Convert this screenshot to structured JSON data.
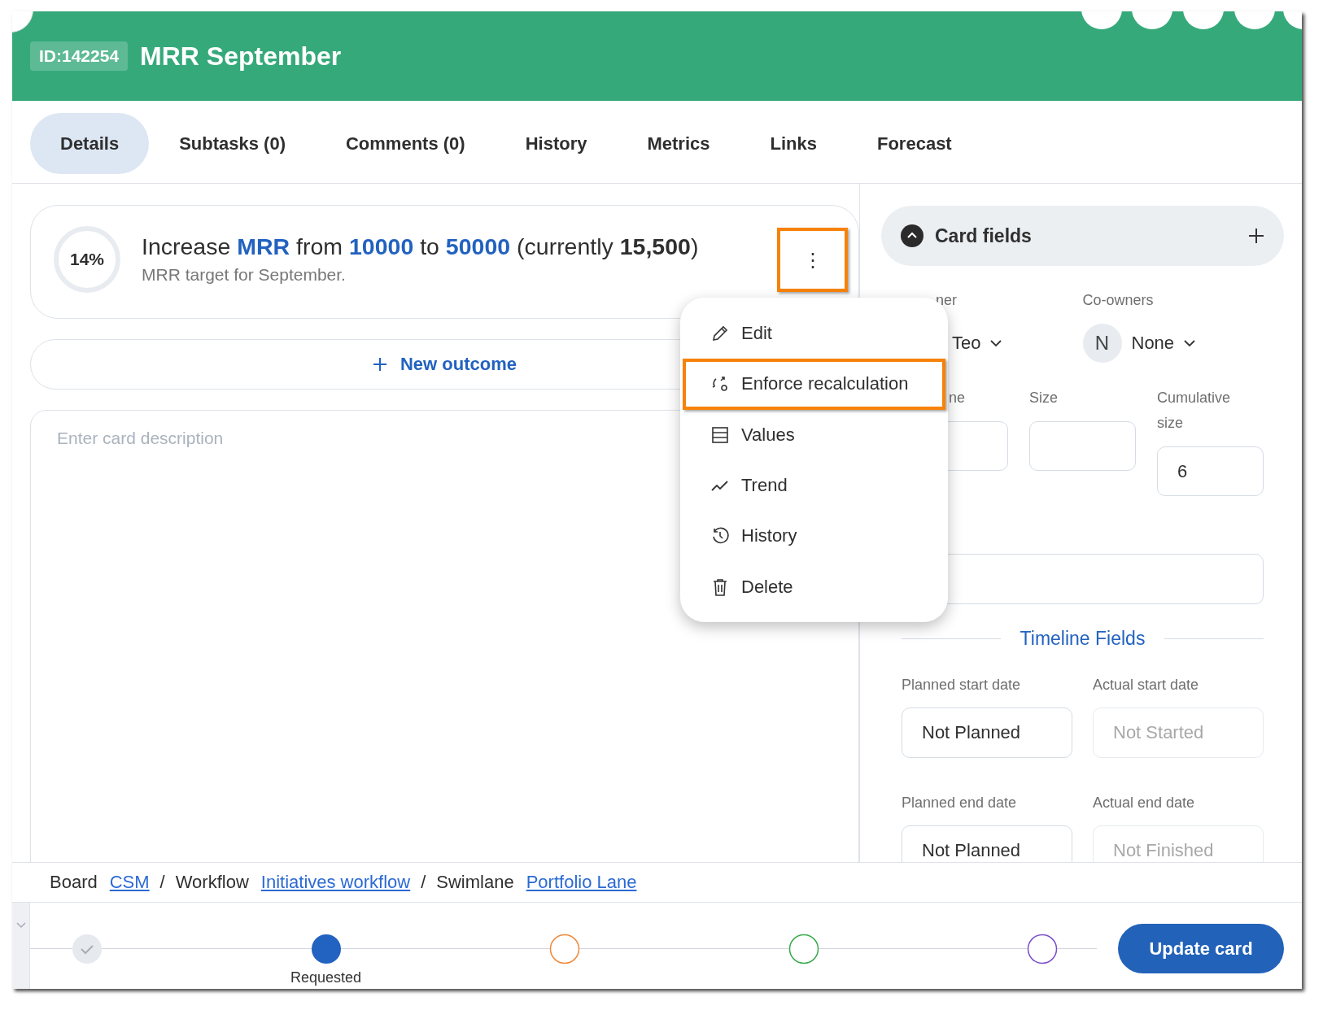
{
  "header": {
    "id_badge": "ID:142254",
    "title": "MRR September"
  },
  "tabs": [
    {
      "label": "Details",
      "selected": true
    },
    {
      "label": "Subtasks (0)",
      "selected": false
    },
    {
      "label": "Comments (0)",
      "selected": false
    },
    {
      "label": "History",
      "selected": false
    },
    {
      "label": "Metrics",
      "selected": false
    },
    {
      "label": "Links",
      "selected": false
    },
    {
      "label": "Forecast",
      "selected": false
    }
  ],
  "outcome": {
    "percent": "14%",
    "parts": [
      {
        "text": "Increase ",
        "kind": "plain"
      },
      {
        "text": "MRR",
        "kind": "accent"
      },
      {
        "text": " from ",
        "kind": "plain"
      },
      {
        "text": "10000",
        "kind": "accent"
      },
      {
        "text": " to ",
        "kind": "plain"
      },
      {
        "text": "50000",
        "kind": "accent"
      },
      {
        "text": " (currently ",
        "kind": "plain"
      },
      {
        "text": "15,500",
        "kind": "strong"
      },
      {
        "text": ")",
        "kind": "plain"
      }
    ],
    "subtitle": "MRR target for September.",
    "more_button": {
      "label": "⋮",
      "highlighted": true
    }
  },
  "new_outcome": "New outcome",
  "description": {
    "placeholder": "Enter card description"
  },
  "menu": [
    {
      "label": "Edit",
      "kind": "pencil",
      "highlighted": false
    },
    {
      "label": "Enforce recalculation",
      "kind": "recalc",
      "highlighted": true
    },
    {
      "label": "Values",
      "kind": "table",
      "highlighted": false
    },
    {
      "label": "Trend",
      "kind": "trend",
      "highlighted": false
    },
    {
      "label": "History",
      "kind": "history",
      "highlighted": false
    },
    {
      "label": "Delete",
      "kind": "trash",
      "highlighted": false
    }
  ],
  "card_fields": {
    "title": "Card fields",
    "owner": {
      "label": "ner",
      "value": "Teo"
    },
    "co_owners": {
      "label": "Co-owners",
      "avatar": "N",
      "value": "None"
    },
    "estimate": {
      "label": "ne"
    },
    "size": {
      "label": "Size"
    },
    "cumulative_size": {
      "label": "Cumulative size",
      "value": "6"
    },
    "timeline_title": "Timeline Fields",
    "dates": [
      {
        "label": "Planned start date",
        "value": "Not Planned"
      },
      {
        "label": "Actual start date",
        "placeholder": "Not Started"
      },
      {
        "label": "Planned end date",
        "value": "Not Planned"
      },
      {
        "label": "Actual end date",
        "placeholder": "Not Finished"
      }
    ]
  },
  "breadcrumb": [
    {
      "text": "Board",
      "kind": "label"
    },
    {
      "text": "CSM",
      "kind": "link"
    },
    {
      "text": "/",
      "kind": "separator"
    },
    {
      "text": "Workflow",
      "kind": "label"
    },
    {
      "text": "Initiatives workflow",
      "kind": "link"
    },
    {
      "text": "/",
      "kind": "separator"
    },
    {
      "text": "Swimlane",
      "kind": "label"
    },
    {
      "text": "Portfolio Lane",
      "kind": "link"
    }
  ],
  "stages": [
    {
      "kind": "done",
      "color": "#e6e9ed"
    },
    {
      "kind": "current",
      "color": "#2262c0",
      "label": "Requested"
    },
    {
      "kind": "pending",
      "color": "#f0893a"
    },
    {
      "kind": "pending",
      "color": "#3aaa4e"
    },
    {
      "kind": "pending",
      "color": "#7a4fc9"
    }
  ],
  "update_button": "Update card"
}
